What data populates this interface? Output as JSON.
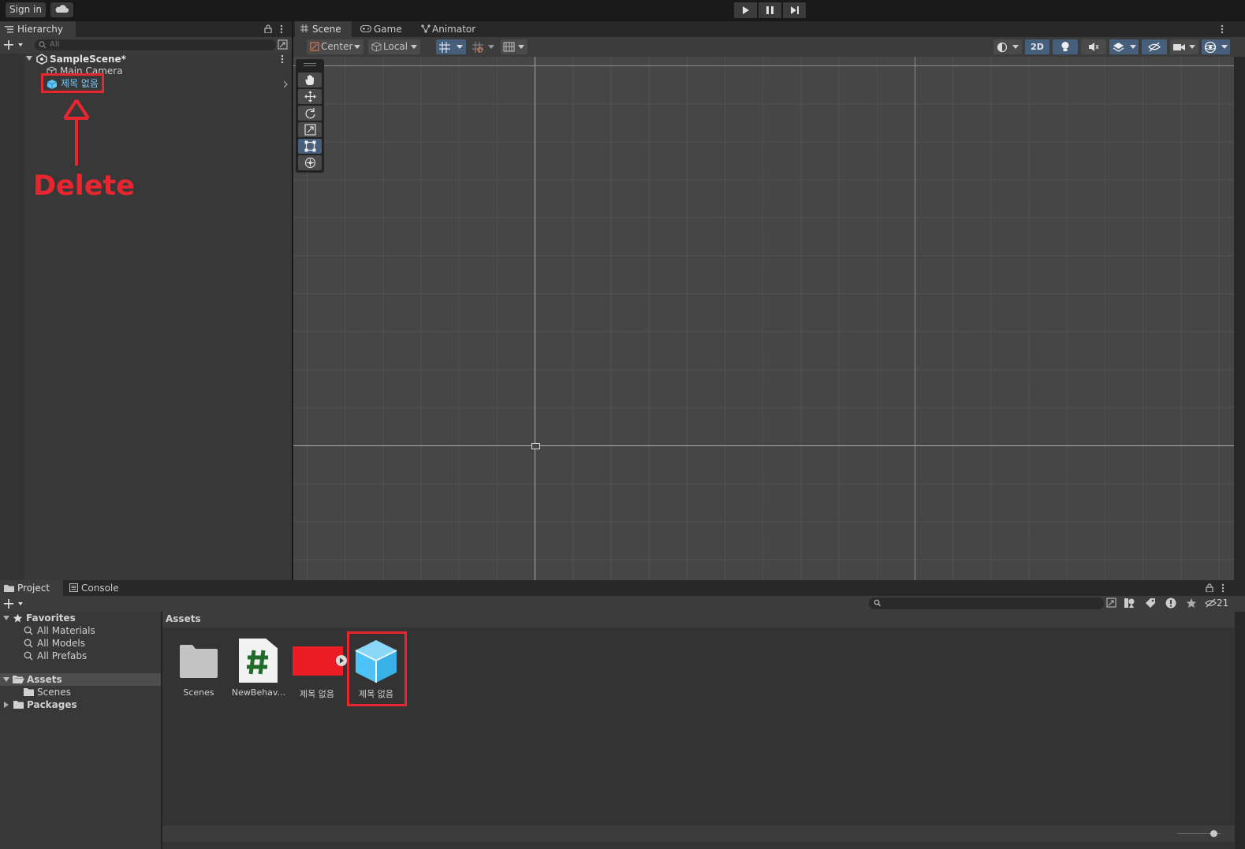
{
  "toolbar": {
    "sign_in": "Sign in"
  },
  "hierarchy": {
    "tab": "Hierarchy",
    "search_placeholder": "All",
    "scene": "SampleScene*",
    "items": [
      {
        "label": "Main Camera"
      },
      {
        "label": "제목 없음"
      }
    ]
  },
  "scene_tabs": [
    {
      "label": "Scene"
    },
    {
      "label": "Game"
    },
    {
      "label": "Animator"
    }
  ],
  "scene_toolbar": {
    "pivot": "Center",
    "space": "Local",
    "mode_2d": "2D"
  },
  "annotation": {
    "text": "Delete",
    "color": "#e8262f"
  },
  "project": {
    "tabs": [
      {
        "label": "Project"
      },
      {
        "label": "Console"
      }
    ],
    "hidden_count": "21",
    "favorites": {
      "label": "Favorites",
      "items": [
        "All Materials",
        "All Models",
        "All Prefabs"
      ]
    },
    "tree": {
      "assets": "Assets",
      "scenes": "Scenes",
      "packages": "Packages"
    },
    "breadcrumb": "Assets",
    "assets": [
      {
        "label": "Scenes",
        "icon": "folder-icon"
      },
      {
        "label": "NewBehav...",
        "icon": "csharp-script-icon"
      },
      {
        "label": "제목 없음",
        "icon": "animation-clip-icon"
      },
      {
        "label": "제목 없음",
        "icon": "prefab-cube-icon"
      }
    ],
    "zoom_slider": 0.85
  },
  "colors": {
    "accent": "#46607c",
    "prefab": "#4fc3f7",
    "highlight": "#e8262f"
  }
}
